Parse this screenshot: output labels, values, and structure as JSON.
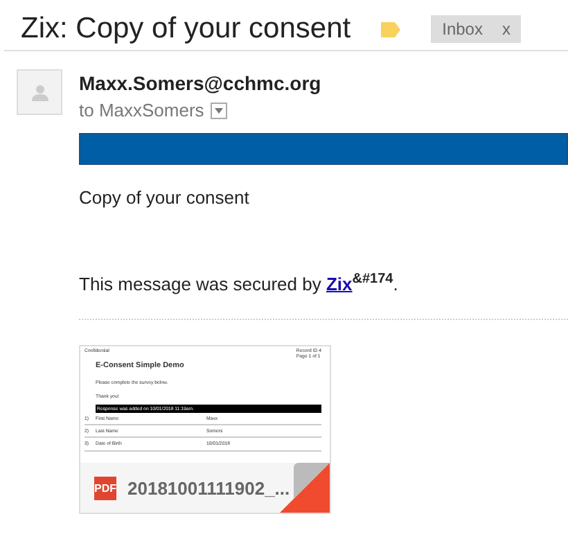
{
  "subject": "Zix: Copy of your consent",
  "labels": [
    {
      "text": "Inbox",
      "close": "x"
    }
  ],
  "message": {
    "sender": "Maxx.Somers@cchmc.org",
    "recipient": "to MaxxSomers",
    "body": "Copy of your consent",
    "footer": "This message was secured by ",
    "footer_link": "Zix",
    "footer_sup": "&#174",
    "footer_end": "."
  },
  "attachment": {
    "file_type": "PDF",
    "file_name": "20181001111902_...",
    "preview": {
      "header": "Confidential",
      "record": "Record ID 4",
      "page": "Page 1 of 1",
      "title": "E-Consent Simple Demo",
      "intro": "Please complete the survey below.",
      "thanks": "Thank you!",
      "banner": "Response was added on 10/01/2018 11:19am.",
      "rows": [
        {
          "num": "1)",
          "field": "First Name",
          "value": "Maxx"
        },
        {
          "num": "2)",
          "field": "Last Name",
          "value": "Somers"
        },
        {
          "num": "3)",
          "field": "Date of Birth",
          "value": "10/01/2018"
        }
      ]
    }
  }
}
